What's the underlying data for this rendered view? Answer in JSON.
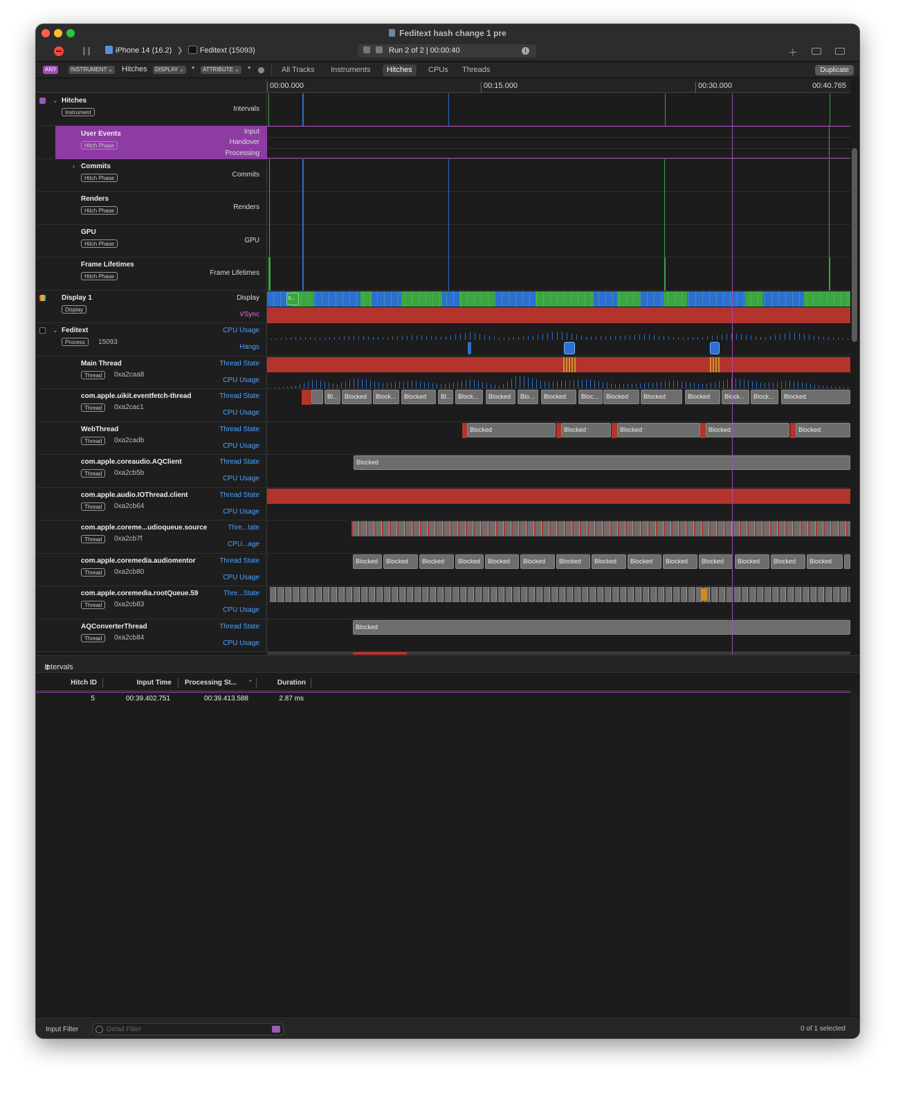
{
  "window": {
    "title": "Feditext hash change 1 pre"
  },
  "toolbar": {
    "device": "iPhone 14 (16.2)",
    "process": "Feditext (15093)",
    "run": "Run 2 of 2",
    "sep": "|",
    "elapsed": "00:00:40"
  },
  "filterbar": {
    "any": "ANY",
    "instrument": "INSTRUMENT",
    "instrument_value": "Hitches",
    "display": "DISPLAY",
    "display_value": "*",
    "attribute": "ATTRIBUTE",
    "attribute_value": "*",
    "tabs": [
      "All Tracks",
      "Instruments",
      "Hitches",
      "CPUs",
      "Threads"
    ],
    "selected_tab": "Hitches",
    "duplicate": "Duplicate"
  },
  "ruler": {
    "ticks": [
      "00:00.000",
      "00:15.000",
      "00:30.000"
    ],
    "end": "00:40.765"
  },
  "tracks": {
    "hitches": {
      "name": "Hitches",
      "badge": "Instrument",
      "lane": "Intervals"
    },
    "user_events": {
      "name": "User Events",
      "badge": "Hitch Phase",
      "lanes": [
        "Input",
        "Handover",
        "Processing"
      ]
    },
    "commits": {
      "name": "Commits",
      "badge": "Hitch Phase",
      "lane": "Commits"
    },
    "renders": {
      "name": "Renders",
      "badge": "Hitch Phase",
      "lane": "Renders"
    },
    "gpu": {
      "name": "GPU",
      "badge": "Hitch Phase",
      "lane": "GPU"
    },
    "frame_lifetimes": {
      "name": "Frame Lifetimes",
      "badge": "Hitch Phase",
      "lane": "Frame Lifetimes"
    },
    "display": {
      "name": "Display 1",
      "badge": "Display",
      "lanes": [
        "Display",
        "VSync"
      ],
      "segment_label": "S..."
    },
    "process": {
      "name": "Feditext",
      "badge": "Process",
      "pid": "15093",
      "lanes": [
        "CPU Usage",
        "Hangs"
      ]
    },
    "threads": [
      {
        "name": "Main Thread",
        "badge": "Thread",
        "tid": "0xa2caa8",
        "lane1": "Thread State",
        "lane2": "CPU Usage"
      },
      {
        "name": "com.apple.uikit.eventfetch-thread",
        "badge": "Thread",
        "tid": "0xa2cac1",
        "lane1": "Thread State",
        "lane2": "CPU Usage"
      },
      {
        "name": "WebThread",
        "badge": "Thread",
        "tid": "0xa2cadb",
        "lane1": "Thread State",
        "lane2": "CPU Usage"
      },
      {
        "name": "com.apple.coreaudio.AQClient",
        "badge": "Thread",
        "tid": "0xa2cb5b",
        "lane1": "Thread State",
        "lane2": "CPU Usage"
      },
      {
        "name": "com.apple.audio.IOThread.client",
        "badge": "Thread",
        "tid": "0xa2cb64",
        "lane1": "Thread State",
        "lane2": "CPU Usage"
      },
      {
        "name": "com.apple.coreme...udioqueue.source",
        "badge": "Thread",
        "tid": "0xa2cb7f",
        "lane1": "Thre...tate",
        "lane2": "CPU...age"
      },
      {
        "name": "com.apple.coremedia.audiomentor",
        "badge": "Thread",
        "tid": "0xa2cb80",
        "lane1": "Thread State",
        "lane2": "CPU Usage"
      },
      {
        "name": "com.apple.coremedia.rootQueue.59",
        "badge": "Thread",
        "tid": "0xa2cb83",
        "lane1": "Thre...State",
        "lane2": "CPU Usage"
      },
      {
        "name": "AQConverterThread",
        "badge": "Thread",
        "tid": "0xa2cb84",
        "lane1": "Thread State",
        "lane2": "CPU Usage"
      }
    ],
    "blocks": {
      "eventfetch": [
        "Bl...",
        "Blocked",
        "Block...",
        "Blocked",
        "Bl...",
        "Block...",
        "Blocked",
        "Blo...",
        "Blocked",
        "Bloc...",
        "Blocked",
        "Blocked",
        "Blocked",
        "Block...",
        "Block...",
        "Blocked"
      ],
      "webthread": [
        "Blocked",
        "Blocked",
        "Blocked",
        "Blocked",
        "Blocked"
      ],
      "aqclient": [
        "Blocked"
      ],
      "audiomentor": [
        "Blocked",
        "Blocked",
        "Blocked",
        "Blocked",
        "Blocked",
        "Blocked",
        "Blocked",
        "Blocked",
        "Blocked",
        "Blocked",
        "Blocked",
        "Blocked",
        "Blocked",
        "Blocked"
      ],
      "aqconverter": [
        "Blocked"
      ]
    }
  },
  "bottom": {
    "view": "Intervals",
    "columns": [
      "Hitch ID",
      "Input Time",
      "Processing St...",
      "Duration"
    ],
    "rows": [
      {
        "hitch_id": "5",
        "input_time": "00:39.402.751",
        "processing_start": "00:39.413.588",
        "duration": "2.87 ms"
      }
    ],
    "input_filter": "Input Filter",
    "detail_filter_placeholder": "Detail Filter",
    "selection": "0 of 1 selected"
  },
  "colors": {
    "accent": "#8e3ca4",
    "red": "#b2342c",
    "blue": "#2b6fd0",
    "green": "#3aa640",
    "gray_block": "#6d6d6d"
  }
}
